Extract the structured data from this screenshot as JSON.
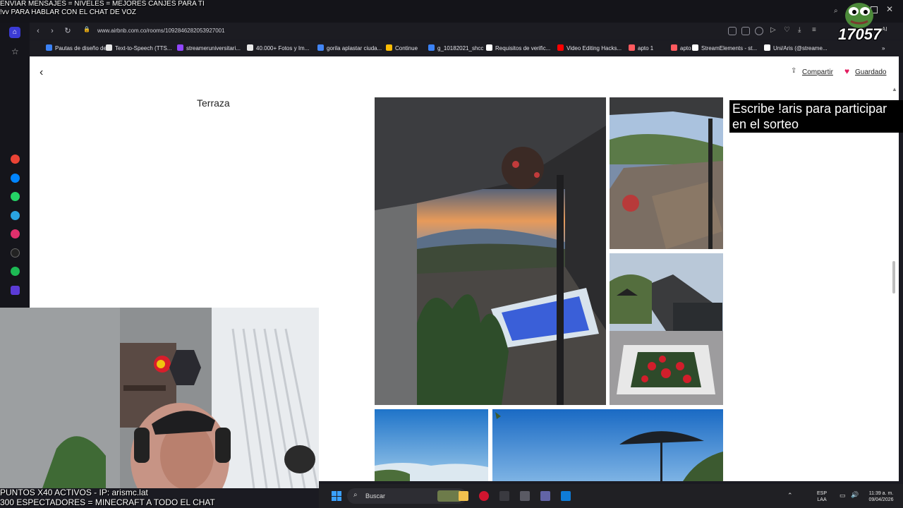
{
  "browser": {
    "url": "www.airbnb.com.co/rooms/1092846282053927001",
    "bookmarks": [
      {
        "label": "Pautas de diseño de...",
        "color": "#3b82f6"
      },
      {
        "label": "Text-to-Speech (TTS...",
        "color": "#e8e8e8"
      },
      {
        "label": "streameruniversitari...",
        "color": "#9146ff"
      },
      {
        "label": "40.000+ Fotos y Im...",
        "color": "#eaeaea"
      },
      {
        "label": "gorila aplastar ciuda...",
        "color": "#4285f4"
      },
      {
        "label": "Continue",
        "color": "#fbbc05"
      },
      {
        "label": "g_10182021_shcc",
        "color": "#3b82f6"
      },
      {
        "label": "Requisitos de verific...",
        "color": "#ffffff"
      },
      {
        "label": "Video Editing Hacks...",
        "color": "#ff0000"
      },
      {
        "label": "apto 1",
        "color": "#ff5a5f"
      },
      {
        "label": "apto 2",
        "color": "#ff5a5f"
      },
      {
        "label": "StreamElements - st...",
        "color": "#ffffff"
      },
      {
        "label": "Uni/Aris (@streame...",
        "color": "#ffffff"
      }
    ],
    "toolbar_ai_label": "AI"
  },
  "page": {
    "share_label": "Compartir",
    "saved_label": "Guardado",
    "section_title": "Terraza",
    "heart_color": "#e31c5f"
  },
  "overlays": {
    "top_line1": "ENVIAR MENSAJES = NIVELES = MEJORES CANJES PARA TI",
    "top_line2": "!vv PARA HABLAR CON EL CHAT DE VOZ",
    "giveaway": "Escribe !aris para participar en el sorteo",
    "bottom_line1": "PUNTOS X40 ACTIVOS - IP: arismc.lat",
    "bottom_line2": "300 ESPECTADORES = MINECRAFT A TODO EL CHAT",
    "pepe_number": "17057"
  },
  "taskbar": {
    "search_placeholder": "Buscar",
    "lang_line1": "ESP",
    "lang_line2": "LAA",
    "time": "11:39 a. m.",
    "date": "09/04/2026"
  }
}
